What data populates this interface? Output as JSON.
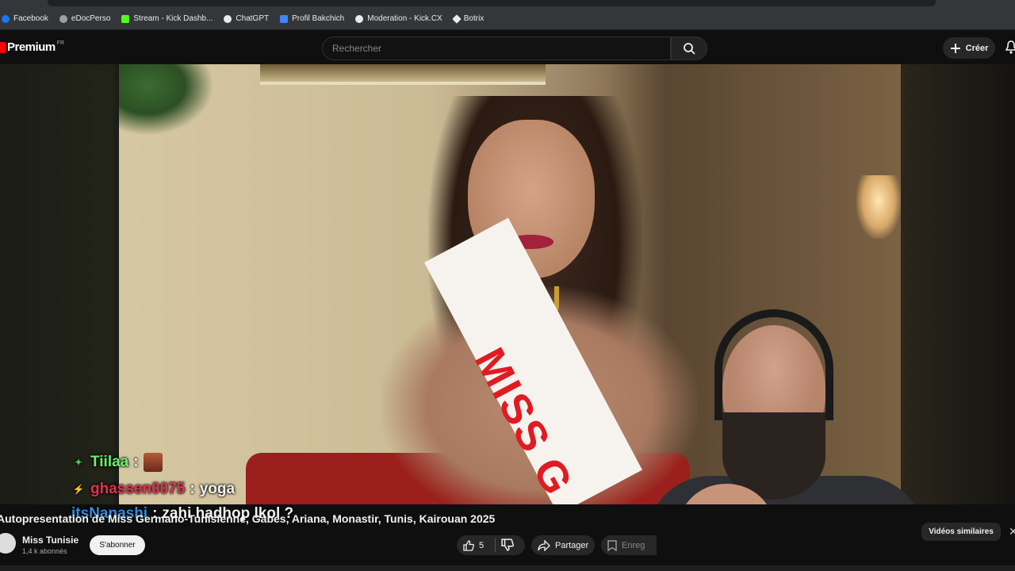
{
  "bookmarks": [
    {
      "label": "Facebook",
      "color": "#1877f2"
    },
    {
      "label": "eDocPerso",
      "color": "#9aa0a6"
    },
    {
      "label": "Stream - Kick Dashb...",
      "color": "#53fc18"
    },
    {
      "label": "ChatGPT",
      "color": "#e8eaed"
    },
    {
      "label": "Profil Bakchich",
      "color": "#4285f4"
    },
    {
      "label": "Moderation - Kick.CX",
      "color": "#e8eaed"
    },
    {
      "label": "Botrix",
      "color": "#e8eaed"
    }
  ],
  "header": {
    "logo_text": "Premium",
    "logo_country": "FR",
    "search_placeholder": "Rechercher",
    "create_label": "Créer"
  },
  "overlay": {
    "sash_text": "MISS G",
    "chat": [
      {
        "user": "Tiilaa",
        "user_color": "#6cf06c",
        "sep": " :",
        "message": ""
      },
      {
        "user": "ghassen0075",
        "user_color": "#e0334d",
        "sep": " :",
        "message": " yoga"
      },
      {
        "user": "itsNanashi",
        "user_color": "#3a8bd8",
        "sep": " :",
        "message": " zahi hadhop lkol ?"
      }
    ]
  },
  "video": {
    "title": "Autopresentation de Miss Germano-Tunisienne, Gabes, Ariana, Monastir, Tunis, Kairouan 2025",
    "channel_name": "Miss Tunisie",
    "subscribers": "1,4 k abonnés",
    "subscribe_label": "S'abonner",
    "likes": "5",
    "share_label": "Partager",
    "save_label": "Enregistrer",
    "similar_label": "Vidéos similaires"
  },
  "colors": {
    "brand_red": "#ff0000",
    "sash_red": "#e11b22",
    "background": "#0f0f0f"
  }
}
